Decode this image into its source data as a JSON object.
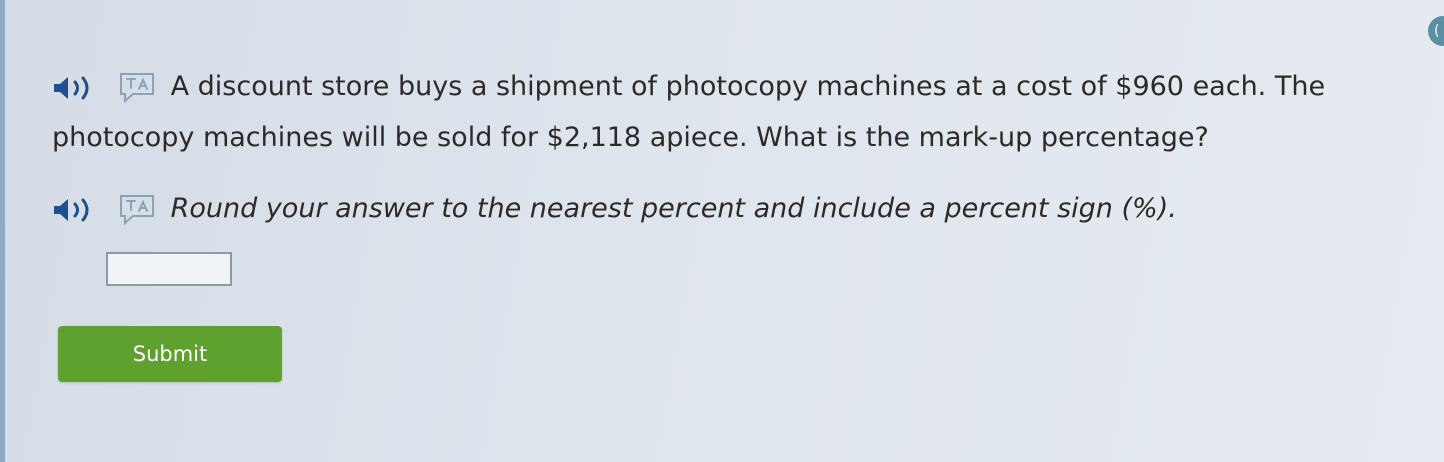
{
  "question": {
    "text": "A discount store buys a shipment of photocopy machines at a cost of $960 each. The photocopy machines will be sold for $2,118 apiece. What is the mark-up percentage?"
  },
  "instruction": {
    "text": "Round your answer to the nearest percent and include a percent sign (%)."
  },
  "answer": {
    "value": "",
    "placeholder": ""
  },
  "submit": {
    "label": "Submit"
  },
  "corner": {
    "text": "("
  },
  "colors": {
    "submit_bg": "#5fa12e",
    "icon_color": "#1f4f8c",
    "translate_icon_color": "#8ca3b3"
  },
  "icons": {
    "speaker": "speaker-icon",
    "translate": "translate-icon"
  }
}
